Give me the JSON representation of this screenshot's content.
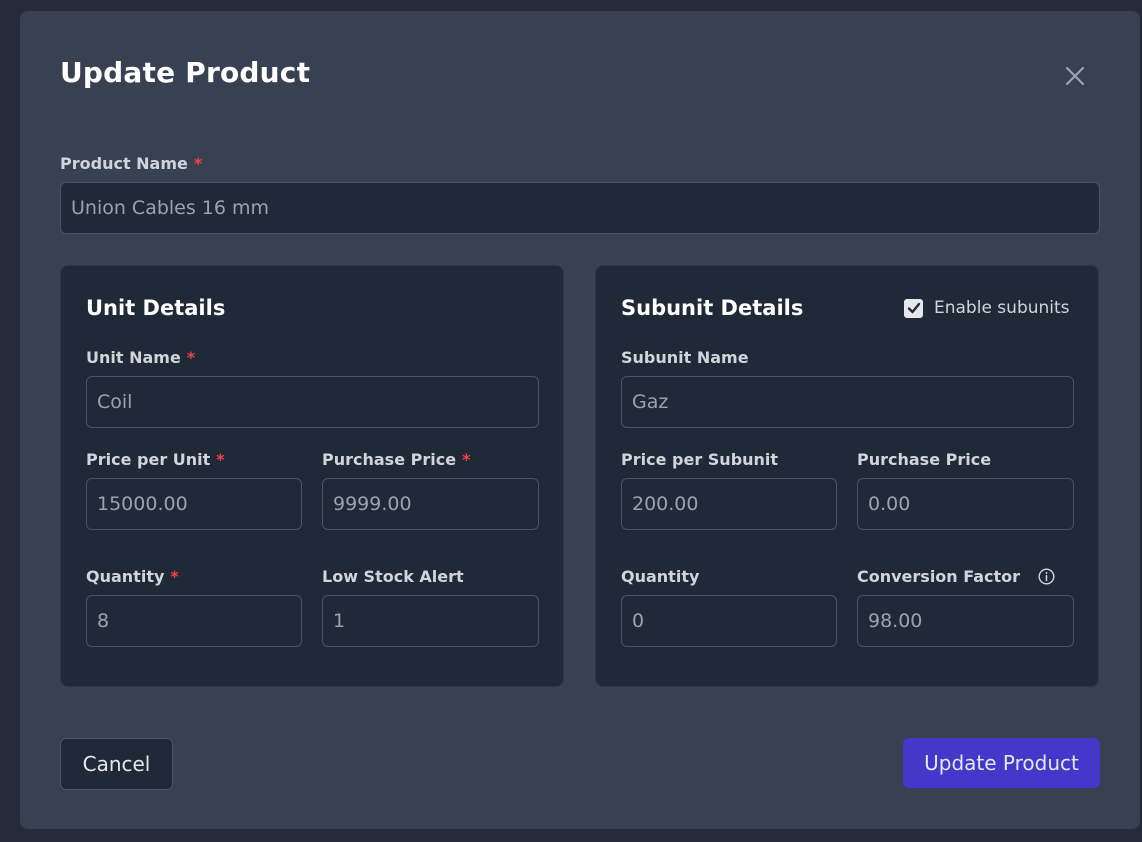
{
  "modal": {
    "title": "Update Product",
    "required_marker": "*"
  },
  "product_name": {
    "label": "Product Name",
    "value": "Union Cables 16 mm"
  },
  "unit_details": {
    "title": "Unit Details",
    "unit_name": {
      "label": "Unit Name",
      "value": "Coil"
    },
    "price_per_unit": {
      "label": "Price per Unit",
      "value": "15000.00"
    },
    "purchase_price": {
      "label": "Purchase Price",
      "value": "9999.00"
    },
    "quantity": {
      "label": "Quantity",
      "value": "8"
    },
    "low_stock_alert": {
      "label": "Low Stock Alert",
      "value": "1"
    }
  },
  "subunit_details": {
    "title": "Subunit Details",
    "enable_subunits": {
      "label": "Enable subunits",
      "checked": true
    },
    "subunit_name": {
      "label": "Subunit Name",
      "value": "Gaz"
    },
    "price_per_subunit": {
      "label": "Price per Subunit",
      "value": "200.00"
    },
    "purchase_price": {
      "label": "Purchase Price",
      "value": "0.00"
    },
    "quantity": {
      "label": "Quantity",
      "value": "0"
    },
    "conversion_factor": {
      "label": "Conversion Factor",
      "value": "98.00"
    }
  },
  "actions": {
    "cancel_label": "Cancel",
    "update_label": "Update Product"
  },
  "icons": {
    "close": "close-icon",
    "checkbox": "check-icon",
    "info": "info-icon"
  },
  "colors": {
    "background": "#252b38",
    "modal": "#374151",
    "panel": "#1f2937",
    "required": "#ef4444",
    "primary_button": "#4338ca"
  }
}
